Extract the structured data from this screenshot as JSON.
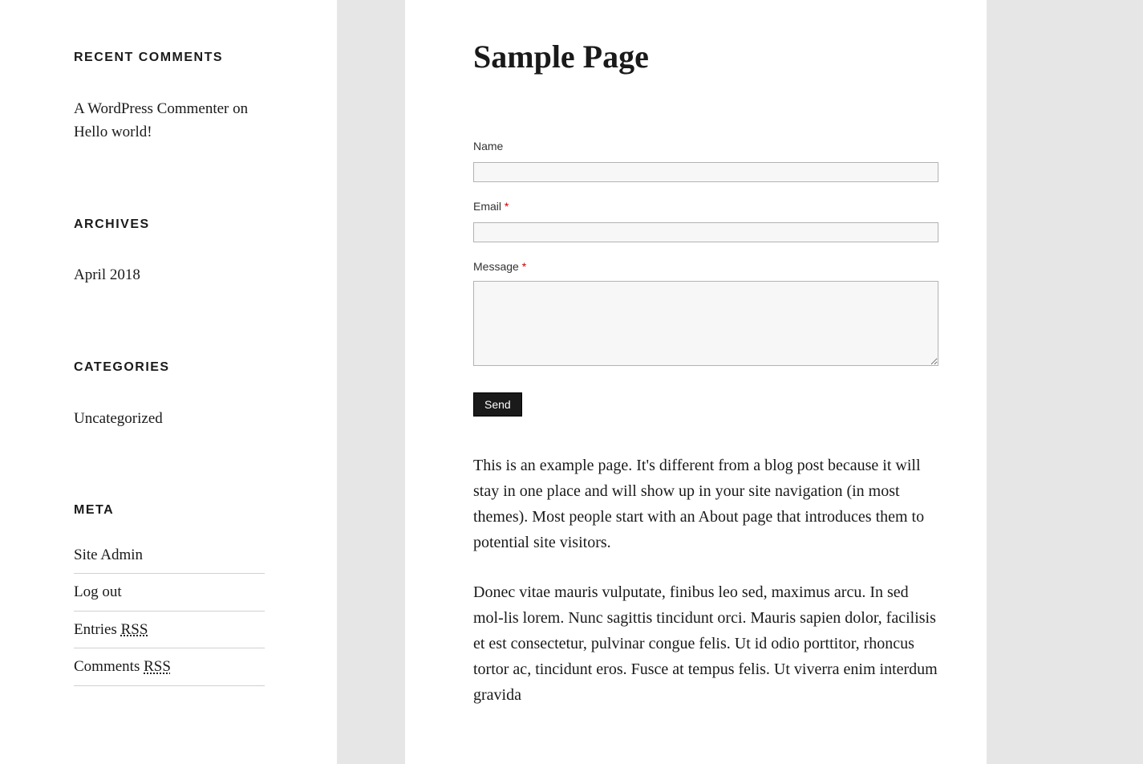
{
  "sidebar": {
    "recent_comments": {
      "title": "RECENT COMMENTS",
      "items": [
        {
          "author": "A WordPress Commenter",
          "on": " on ",
          "post": "Hello world!"
        }
      ]
    },
    "archives": {
      "title": "ARCHIVES",
      "items": [
        "April 2018"
      ]
    },
    "categories": {
      "title": "CATEGORIES",
      "items": [
        "Uncategorized"
      ]
    },
    "meta": {
      "title": "META",
      "items": [
        {
          "label": "Site Admin",
          "abbr": null
        },
        {
          "label": "Log out",
          "abbr": null
        },
        {
          "label": "Entries ",
          "abbr": "RSS"
        },
        {
          "label": "Comments ",
          "abbr": "RSS"
        }
      ]
    }
  },
  "main": {
    "title": "Sample Page",
    "form": {
      "name_label": "Name",
      "email_label": "Email ",
      "message_label": "Message ",
      "required_mark": "*",
      "send_label": "Send"
    },
    "paragraphs": [
      "This is an example page. It's different from a blog post because it will stay in one place and will show up in your site navigation (in most themes). Most people start with an About page that introduces them to potential site visitors.",
      "Donec vitae mauris vulputate, finibus leo sed, maximus arcu. In sed mol-lis lorem. Nunc sagittis tincidunt orci. Mauris sapien dolor, facilisis et est consectetur, pulvinar congue felis. Ut id odio porttitor, rhoncus tortor ac, tincidunt eros. Fusce at tempus felis. Ut viverra enim interdum gravida"
    ]
  }
}
